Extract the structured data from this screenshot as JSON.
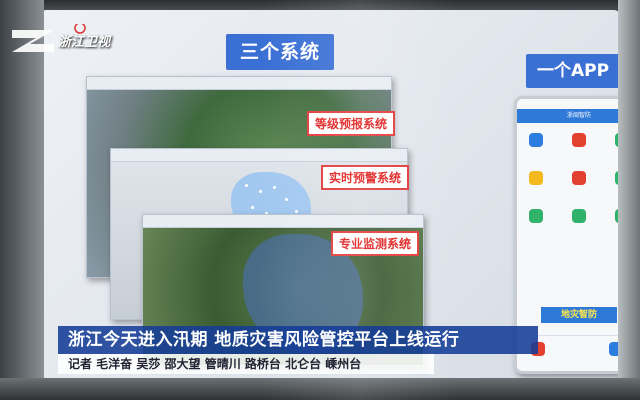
{
  "channel_logo": {
    "text": "浙江卫视"
  },
  "board": {
    "systems_title": "三个系统",
    "app_title": "一个APP"
  },
  "windows": [
    {
      "label": "等级预报系统"
    },
    {
      "label": "实时预警系统"
    },
    {
      "label": "专业监测系统"
    }
  ],
  "phone": {
    "header": "浙闽智防",
    "button": "地灾智防"
  },
  "news": {
    "headline": "浙江今天进入汛期  地质灾害风险管控平台上线运行",
    "credits": "记者  毛洋奋  吴莎  邵大望  管晴川  路桥台  北仑台  嵊州台"
  },
  "colors": {
    "board_accent": "#3a6fd4",
    "label_red": "#e02020",
    "headline_bg": "#143c96"
  }
}
